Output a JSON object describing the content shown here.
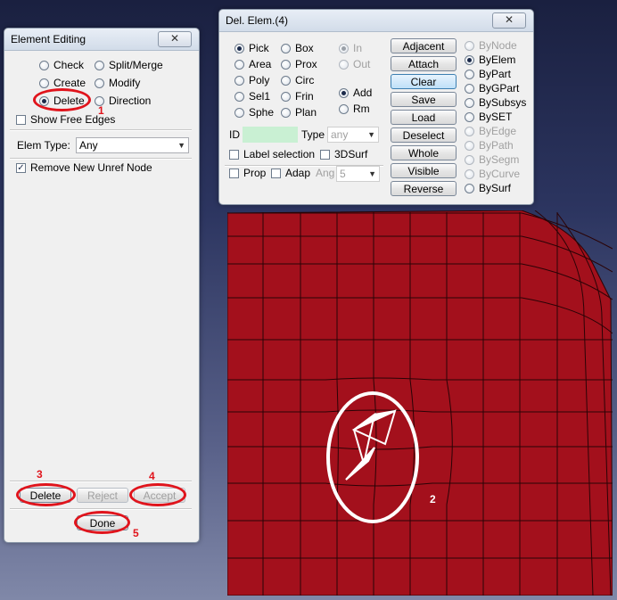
{
  "element_editing": {
    "title": "Element Editing",
    "close_label": "✕",
    "ops": [
      {
        "label": "Check",
        "selected": false
      },
      {
        "label": "Split/Merge",
        "selected": false
      },
      {
        "label": "Create",
        "selected": false
      },
      {
        "label": "Modify",
        "selected": false
      },
      {
        "label": "Delete",
        "selected": true
      },
      {
        "label": "Direction",
        "selected": false
      }
    ],
    "show_free_edges": {
      "label": "Show Free Edges",
      "checked": false
    },
    "elem_type_label": "Elem Type:",
    "elem_type_value": "Any",
    "remove_unref": {
      "label": "Remove New Unref Node",
      "checked": true
    },
    "buttons": {
      "delete": "Delete",
      "reject": "Reject",
      "accept": "Accept",
      "done": "Done"
    }
  },
  "del_elem": {
    "title": "Del. Elem.(4)",
    "close_label": "✕",
    "pick_modes": [
      {
        "label": "Pick",
        "selected": true
      },
      {
        "label": "Box",
        "selected": false
      },
      {
        "label": "Area",
        "selected": false
      },
      {
        "label": "Prox",
        "selected": false
      },
      {
        "label": "Poly",
        "selected": false
      },
      {
        "label": "Circ",
        "selected": false
      },
      {
        "label": "Sel1",
        "selected": false
      },
      {
        "label": "Frin",
        "selected": false
      },
      {
        "label": "Sphe",
        "selected": false
      },
      {
        "label": "Plan",
        "selected": false
      }
    ],
    "in_label": "In",
    "out_label": "Out",
    "add_label": "Add",
    "rm_label": "Rm",
    "id_label": "ID",
    "type_label": "Type",
    "type_value": "any",
    "label_selection": "Label selection",
    "surf3d": "3DSurf",
    "prop_label": "Prop",
    "adap_label": "Adap",
    "ang_label": "Ang",
    "ang_value": "5",
    "buttons": [
      "Adjacent",
      "Attach",
      "Clear",
      "Save",
      "Load",
      "Deselect",
      "Whole",
      "Visible",
      "Reverse"
    ],
    "by_options": [
      {
        "label": "ByNode",
        "selected": false,
        "enabled": false
      },
      {
        "label": "ByElem",
        "selected": true,
        "enabled": true
      },
      {
        "label": "ByPart",
        "selected": false,
        "enabled": true
      },
      {
        "label": "ByGPart",
        "selected": false,
        "enabled": true
      },
      {
        "label": "BySubsys",
        "selected": false,
        "enabled": true
      },
      {
        "label": "BySET",
        "selected": false,
        "enabled": true
      },
      {
        "label": "ByEdge",
        "selected": false,
        "enabled": false
      },
      {
        "label": "ByPath",
        "selected": false,
        "enabled": false
      },
      {
        "label": "BySegm",
        "selected": false,
        "enabled": false
      },
      {
        "label": "ByCurve",
        "selected": false,
        "enabled": false
      },
      {
        "label": "BySurf",
        "selected": false,
        "enabled": true
      }
    ]
  },
  "annotations": [
    "1",
    "2",
    "3",
    "4",
    "5"
  ],
  "colors": {
    "mesh": "#a3101c",
    "mesh_line": "#2a0306",
    "annotation": "#e0141c",
    "highlight": "#c9f0d3"
  }
}
